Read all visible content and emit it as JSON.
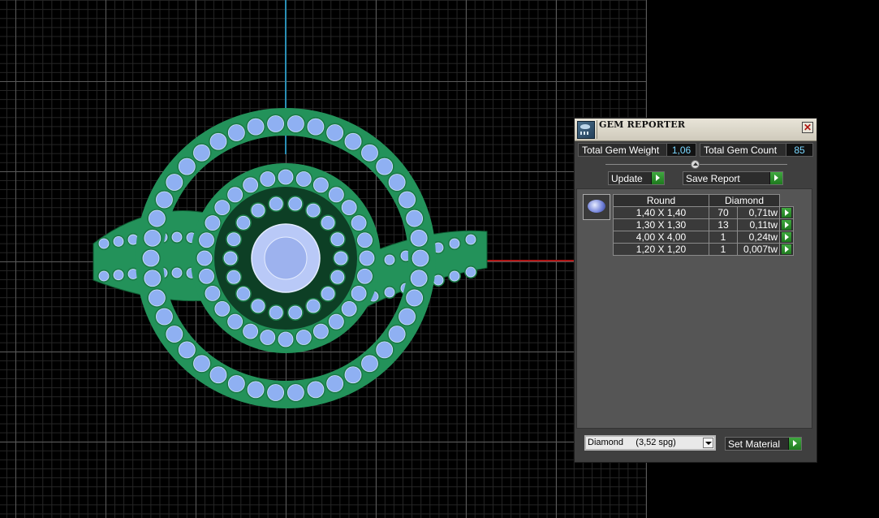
{
  "panel": {
    "title": "GEM REPORTER",
    "close_glyph": "✕",
    "total_weight_label": "Total Gem Weight",
    "total_weight_value": "1,06",
    "total_count_label": "Total Gem Count",
    "total_count_value": "85",
    "update_label": "Update",
    "save_report_label": "Save Report",
    "table": {
      "shape_header": "Round",
      "material_header": "Diamond",
      "rows": [
        {
          "size": "1,40 X 1,40",
          "count": "70",
          "weight": "0,71tw"
        },
        {
          "size": "1,30 X 1,30",
          "count": "13",
          "weight": "0,11tw"
        },
        {
          "size": "4,00 X 4,00",
          "count": "1",
          "weight": "0,24tw"
        },
        {
          "size": "1,20 X 1,20",
          "count": "1",
          "weight": "0,007tw"
        }
      ]
    },
    "material_select_value": "Diamond     (3,52 spg)",
    "set_material_label": "Set Material"
  },
  "icons": [
    "gem-reporter-icon",
    "close-icon",
    "arrow-right-icon",
    "gem-thumbnail-icon",
    "dropdown-arrow-icon"
  ],
  "colors": {
    "ring_metal": "#23925a",
    "gems": "#8fb0f2",
    "value_text": "#7ad7ff",
    "button_arrow": "#2f9a2f",
    "axis_y": "#2a8fb5",
    "axis_x": "#b01515"
  }
}
